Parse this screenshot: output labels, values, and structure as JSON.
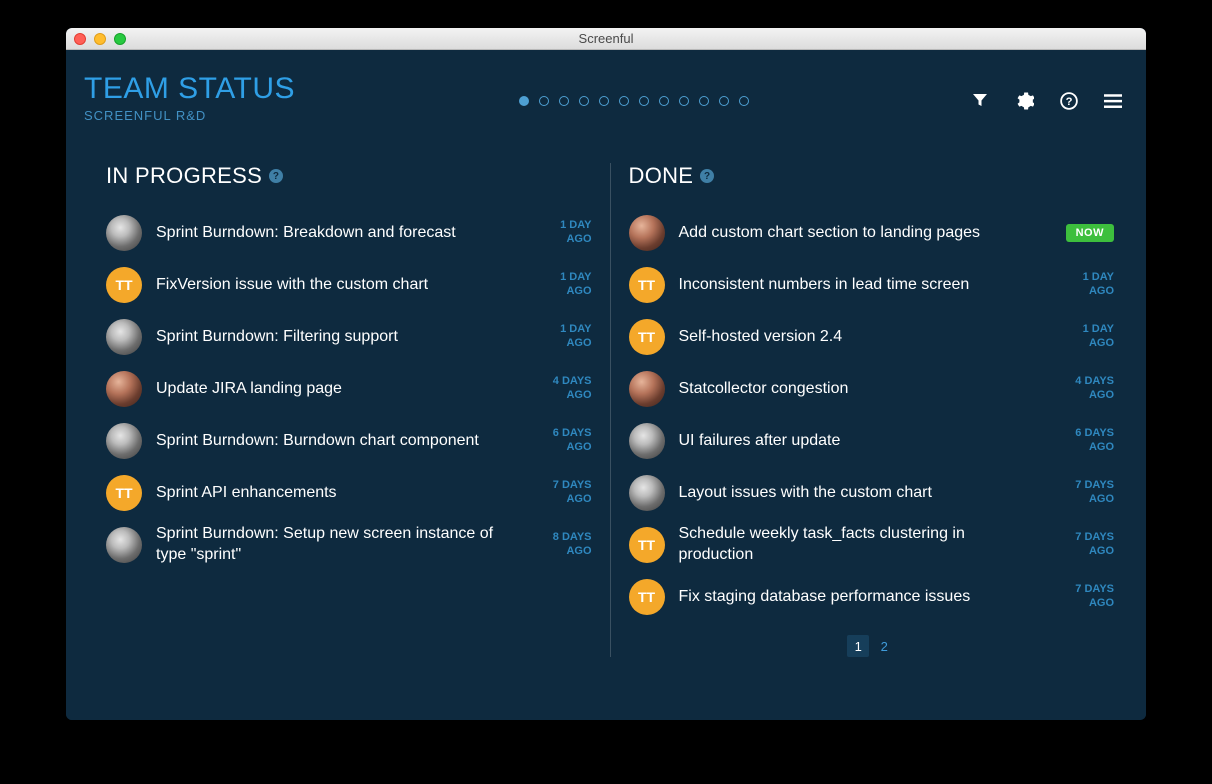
{
  "window": {
    "title": "Screenful"
  },
  "header": {
    "title": "TEAM STATUS",
    "subtitle": "SCREENFUL R&D"
  },
  "pager": {
    "count": 12,
    "active": 0
  },
  "columns": [
    {
      "title": "IN PROGRESS",
      "items": [
        {
          "avatar": "grey",
          "text": "",
          "title": "Sprint Burndown: Breakdown and forecast",
          "time": "1 DAY AGO"
        },
        {
          "avatar": "orange",
          "text": "TT",
          "title": "FixVersion issue with the custom chart",
          "time": "1 DAY AGO"
        },
        {
          "avatar": "grey",
          "text": "",
          "title": "Sprint Burndown: Filtering support",
          "time": "1 DAY AGO"
        },
        {
          "avatar": "photo",
          "text": "",
          "title": "Update JIRA landing page",
          "time": "4 DAYS AGO"
        },
        {
          "avatar": "grey",
          "text": "",
          "title": "Sprint Burndown: Burndown chart component",
          "time": "6 DAYS AGO"
        },
        {
          "avatar": "orange",
          "text": "TT",
          "title": "Sprint API enhancements",
          "time": "7 DAYS AGO"
        },
        {
          "avatar": "grey",
          "text": "",
          "title": "Sprint Burndown: Setup new screen instance of type \"sprint\"",
          "time": "8 DAYS AGO"
        }
      ]
    },
    {
      "title": "DONE",
      "items": [
        {
          "avatar": "photo",
          "text": "",
          "title": "Add custom chart section to landing pages",
          "now": true,
          "nowLabel": "NOW"
        },
        {
          "avatar": "orange",
          "text": "TT",
          "title": "Inconsistent numbers in lead time screen",
          "time": "1 DAY AGO"
        },
        {
          "avatar": "orange",
          "text": "TT",
          "title": "Self-hosted version 2.4",
          "time": "1 DAY AGO"
        },
        {
          "avatar": "photo",
          "text": "",
          "title": "Statcollector congestion",
          "time": "4 DAYS AGO"
        },
        {
          "avatar": "grey",
          "text": "",
          "title": "UI failures after update",
          "time": "6 DAYS AGO"
        },
        {
          "avatar": "grey",
          "text": "",
          "title": "Layout issues with the custom chart",
          "time": "7 DAYS AGO"
        },
        {
          "avatar": "orange",
          "text": "TT",
          "title": "Schedule weekly task_facts clustering in production",
          "time": "7 DAYS AGO"
        },
        {
          "avatar": "orange",
          "text": "TT",
          "title": "Fix staging database performance issues",
          "time": "7 DAYS AGO"
        }
      ],
      "pages": [
        "1",
        "2"
      ],
      "activePage": 0
    }
  ]
}
